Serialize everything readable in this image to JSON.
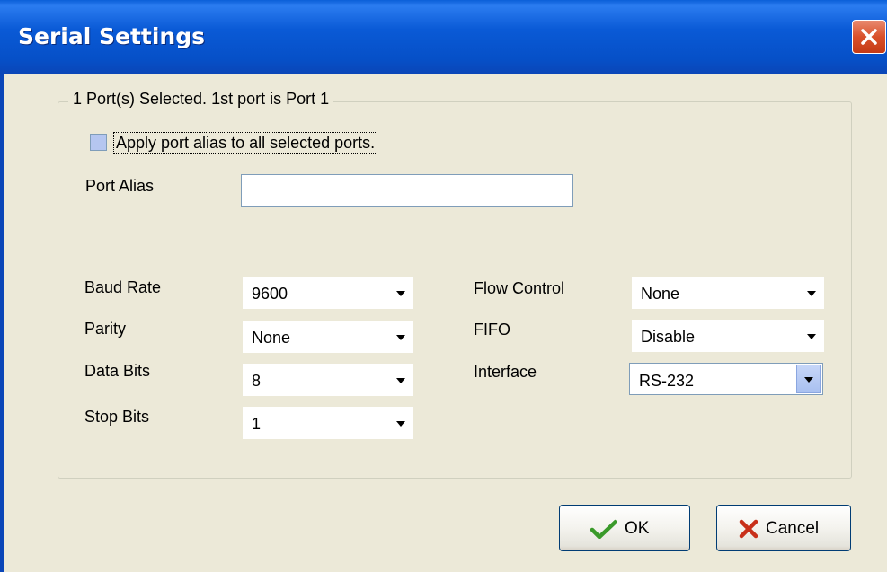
{
  "window": {
    "title": "Serial Settings"
  },
  "group": {
    "title": "1 Port(s) Selected. 1st port is Port 1"
  },
  "apply_alias": {
    "label": "Apply port alias to all selected ports.",
    "checked": false
  },
  "port_alias": {
    "label": "Port Alias",
    "value": ""
  },
  "left_fields": [
    {
      "label": "Baud Rate",
      "value": "9600"
    },
    {
      "label": "Parity",
      "value": "None"
    },
    {
      "label": "Data Bits",
      "value": "8"
    },
    {
      "label": "Stop Bits",
      "value": "1"
    }
  ],
  "right_fields": [
    {
      "label": "Flow Control",
      "value": "None"
    },
    {
      "label": "FIFO",
      "value": "Disable"
    },
    {
      "label": "Interface",
      "value": "RS-232"
    }
  ],
  "buttons": {
    "ok": "OK",
    "cancel": "Cancel"
  },
  "icons": {
    "close": "close-icon",
    "ok": "checkmark-icon",
    "cancel": "x-icon",
    "dropdown": "triangle-down-icon"
  },
  "colors": {
    "titlebar": "#0a5ad6",
    "close": "#d9502a",
    "checkmark": "#3a9a2a",
    "cancel_x": "#c8301a"
  }
}
